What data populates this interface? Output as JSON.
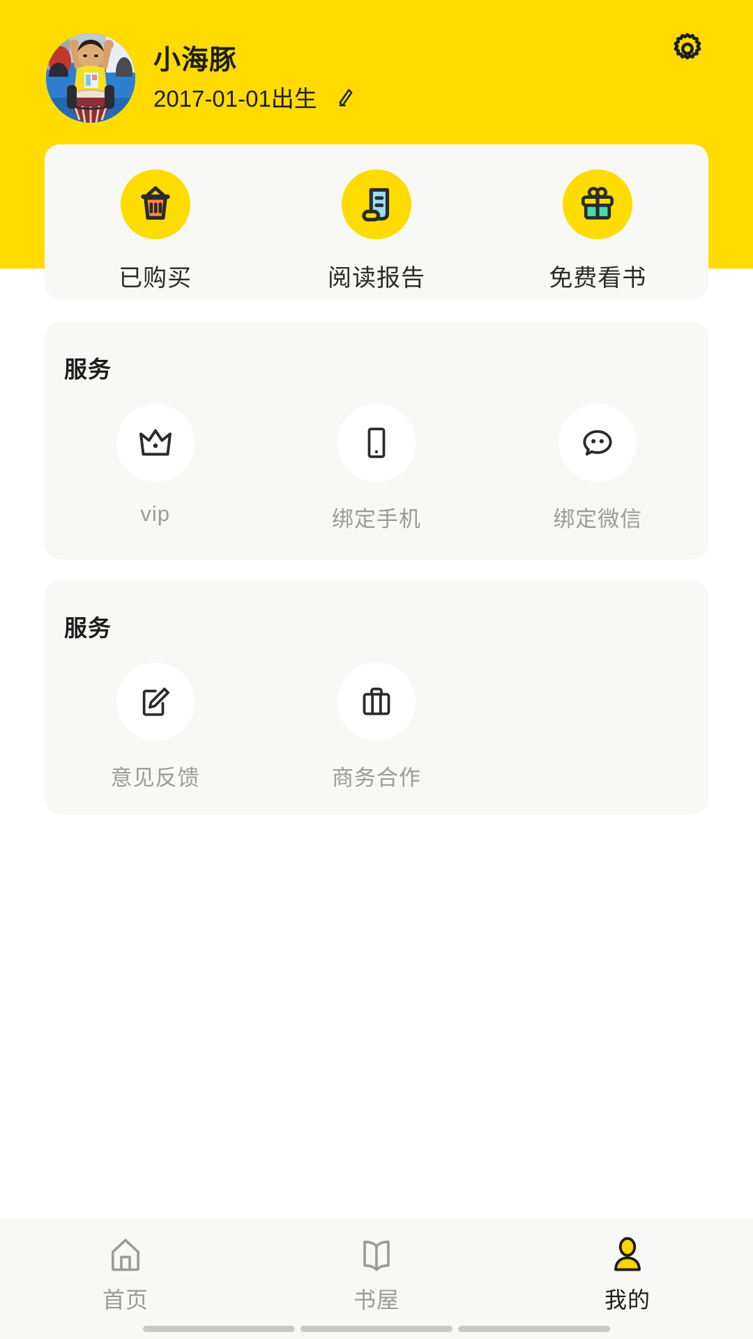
{
  "header": {
    "background_color": "#FFDB00",
    "profile": {
      "name": "小海豚",
      "birth_text": "2017-01-01出生",
      "edit_icon": "pencil-icon",
      "avatar_alt": "child-playing-drum-photo"
    },
    "settings_icon": "gear-icon"
  },
  "quick_actions": {
    "items": [
      {
        "label": "已购买",
        "icon": "basket-icon",
        "icon_bg": "#FFDC00",
        "icon_accent": "#FF8A3D"
      },
      {
        "label": "阅读报告",
        "icon": "report-scroll-icon",
        "icon_bg": "#FFDC00",
        "icon_accent": "#9BDCF7"
      },
      {
        "label": "免费看书",
        "icon": "gift-icon",
        "icon_bg": "#FFDC00",
        "icon_accent": "#45DBA6"
      }
    ]
  },
  "service_section_1": {
    "title": "服务",
    "items": [
      {
        "label": "vip",
        "icon": "crown-icon"
      },
      {
        "label": "绑定手机",
        "icon": "phone-icon"
      },
      {
        "label": "绑定微信",
        "icon": "wechat-icon"
      }
    ]
  },
  "service_section_2": {
    "title": "服务",
    "items": [
      {
        "label": "意见反馈",
        "icon": "feedback-edit-icon"
      },
      {
        "label": "商务合作",
        "icon": "briefcase-icon"
      }
    ]
  },
  "bottom_nav": {
    "active_color": "#FFD400",
    "inactive_color": "#9b9b9b",
    "items": [
      {
        "label": "首页",
        "icon": "home-icon",
        "active": false
      },
      {
        "label": "书屋",
        "icon": "book-icon",
        "active": false
      },
      {
        "label": "我的",
        "icon": "person-icon",
        "active": true
      }
    ]
  }
}
